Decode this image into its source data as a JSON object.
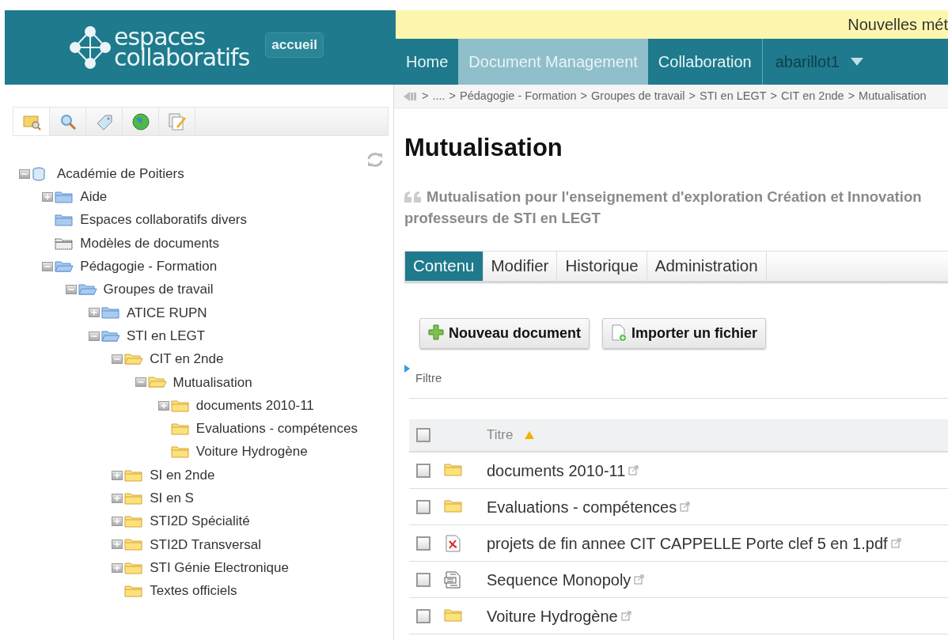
{
  "header": {
    "logo_text": [
      "espaces",
      "collaboratifs"
    ],
    "home_badge": "accueil",
    "notice": "Nouvelles mét",
    "nav": [
      {
        "label": "Home",
        "selected": false
      },
      {
        "label": "Document Management",
        "selected": true
      },
      {
        "label": "Collaboration",
        "selected": false
      }
    ],
    "user": "abarillot1"
  },
  "sidebar": {
    "tabs": [
      {
        "kind": "browse",
        "selected": true
      },
      {
        "kind": "search",
        "selected": false
      },
      {
        "kind": "tag",
        "selected": false
      },
      {
        "kind": "globe",
        "selected": false
      },
      {
        "kind": "edit",
        "selected": false
      }
    ],
    "tree": [
      {
        "label": "Académie de Poitiers",
        "kind": "database",
        "expanded": true,
        "children": [
          {
            "label": "Aide",
            "kind": "space",
            "expanded": false
          },
          {
            "label": "Espaces collaboratifs divers",
            "kind": "space"
          },
          {
            "label": "Modèles de documents",
            "kind": "template"
          },
          {
            "label": "Pédagogie - Formation",
            "kind": "space",
            "expanded": true,
            "children": [
              {
                "label": "Groupes de travail",
                "kind": "space",
                "expanded": true,
                "children": [
                  {
                    "label": "ATICE RUPN",
                    "kind": "space",
                    "expanded": false
                  },
                  {
                    "label": "STI en LEGT",
                    "kind": "space",
                    "expanded": true,
                    "children": [
                      {
                        "label": "CIT en 2nde",
                        "kind": "folder",
                        "expanded": true,
                        "children": [
                          {
                            "label": "Mutualisation",
                            "kind": "folder",
                            "expanded": true,
                            "children": [
                              {
                                "label": "documents 2010-11",
                                "kind": "folder",
                                "expanded": false
                              },
                              {
                                "label": "Evaluations - compétences",
                                "kind": "folder"
                              },
                              {
                                "label": "Voiture Hydrogène",
                                "kind": "folder"
                              }
                            ]
                          }
                        ]
                      },
                      {
                        "label": "SI en 2nde",
                        "kind": "folder",
                        "expanded": false
                      },
                      {
                        "label": "SI en S",
                        "kind": "folder",
                        "expanded": false
                      },
                      {
                        "label": "STI2D Spécialité",
                        "kind": "folder",
                        "expanded": false
                      },
                      {
                        "label": "STI2D Transversal",
                        "kind": "folder",
                        "expanded": false
                      },
                      {
                        "label": "STI Génie Electronique",
                        "kind": "folder",
                        "expanded": false
                      },
                      {
                        "label": "Textes officiels",
                        "kind": "folder"
                      }
                    ]
                  }
                ]
              }
            ]
          }
        ]
      }
    ]
  },
  "breadcrumb": [
    ">",
    "....",
    ">",
    "Pédagogie - Formation",
    ">",
    "Groupes de travail",
    ">",
    "STI en LEGT",
    ">",
    "CIT en 2nde",
    ">",
    "Mutualisation"
  ],
  "title": "Mutualisation",
  "description": "Mutualisation pour l'enseignement d'exploration Création et Innovation professeurs de STI en LEGT",
  "tabs": [
    {
      "label": "Contenu",
      "selected": true
    },
    {
      "label": "Modifier",
      "selected": false
    },
    {
      "label": "Historique",
      "selected": false
    },
    {
      "label": "Administration",
      "selected": false
    }
  ],
  "buttons": [
    {
      "label": "Nouveau document",
      "kind": "new"
    },
    {
      "label": "Importer un fichier",
      "kind": "import"
    }
  ],
  "filter": {
    "label": "Filtre",
    "expanded": false
  },
  "table": {
    "select_all": {
      "checked": false
    },
    "column": "Titre",
    "sorted": true,
    "rows": [
      {
        "title": "documents 2010-11",
        "kind": "folder",
        "checked": false
      },
      {
        "title": "Evaluations - compétences",
        "kind": "folder",
        "checked": false
      },
      {
        "title": "projets de fin annee CIT CAPPELLE Porte clef 5 en 1.pdf",
        "kind": "pdf",
        "checked": false
      },
      {
        "title": "Sequence Monopoly",
        "kind": "sif",
        "checked": false
      },
      {
        "title": "Voiture Hydrogène",
        "kind": "folder",
        "checked": false
      }
    ]
  }
}
